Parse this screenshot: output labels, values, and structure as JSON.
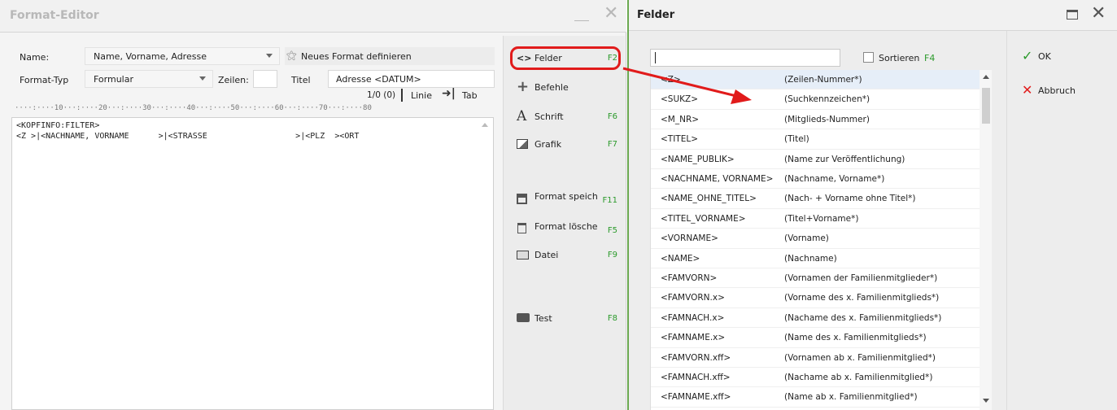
{
  "left_window": {
    "title": "Format-Editor",
    "name_label": "Name:",
    "name_value": "Name, Vorname, Adresse",
    "new_format_label": "Neues Format definieren",
    "type_label": "Format-Typ",
    "type_value": "Formular",
    "zeilen_label": "Zeilen:",
    "titel_label": "Titel",
    "titel_value": "Adresse <DATUM>",
    "position": "1/0 (0)",
    "linie_label": "Linie",
    "tab_label": "Tab",
    "ruler": "····:····10···:····20···:····30···:····40···:····50···:····60···:····70···:····80",
    "editor_lines": [
      "<KOPFINFO:FILTER>",
      "<Z >|<NACHNAME, VORNAME      >|<STRASSE                  >|<PLZ  ><ORT"
    ]
  },
  "toolbar": {
    "felder": {
      "label": "Felder",
      "key": "F2"
    },
    "befehle": {
      "label": "Befehle",
      "key": ""
    },
    "schrift": {
      "label": "Schrift",
      "key": "F6"
    },
    "grafik": {
      "label": "Grafik",
      "key": "F7"
    },
    "speichern": {
      "label": "Format speich",
      "key": "F11"
    },
    "loeschen": {
      "label": "Format lösche",
      "key": "F5"
    },
    "datei": {
      "label": "Datei",
      "key": "F9"
    },
    "test": {
      "label": "Test",
      "key": "F8"
    }
  },
  "right_window": {
    "title": "Felder",
    "search_value": "",
    "sort_label": "Sortieren",
    "sort_key": "F4",
    "ok_label": "OK",
    "cancel_label": "Abbruch",
    "fields": [
      {
        "code": "<Z>",
        "desc": "(Zeilen-Nummer*)"
      },
      {
        "code": "<SUKZ>",
        "desc": "(Suchkennzeichen*)"
      },
      {
        "code": "<M_NR>",
        "desc": "(Mitglieds-Nummer)"
      },
      {
        "code": "<TITEL>",
        "desc": "(Titel)"
      },
      {
        "code": "<NAME_PUBLIK>",
        "desc": "(Name zur Veröffentlichung)"
      },
      {
        "code": "<NACHNAME, VORNAME>",
        "desc": "(Nachname, Vorname*)"
      },
      {
        "code": "<NAME_OHNE_TITEL>",
        "desc": "(Nach- + Vorname ohne Titel*)"
      },
      {
        "code": "<TITEL_VORNAME>",
        "desc": "(Titel+Vorname*)"
      },
      {
        "code": "<VORNAME>",
        "desc": "(Vorname)"
      },
      {
        "code": "<NAME>",
        "desc": "(Nachname)"
      },
      {
        "code": "<FAMVORN>",
        "desc": "(Vornamen der Familienmitglieder*)"
      },
      {
        "code": "<FAMVORN.x>",
        "desc": "(Vorname des x. Familienmitglieds*)"
      },
      {
        "code": "<FAMNACH.x>",
        "desc": "(Nachame des x. Familienmitglieds*)"
      },
      {
        "code": "<FAMNAME.x>",
        "desc": "(Name des x. Familienmitglieds*)"
      },
      {
        "code": "<FAMVORN.xff>",
        "desc": "(Vornamen ab x. Familienmitglied*)"
      },
      {
        "code": "<FAMNACH.xff>",
        "desc": "(Nachame ab x. Familienmitglied*)"
      },
      {
        "code": "<FAMNAME.xff>",
        "desc": "(Name ab x. Familienmitglied*)"
      }
    ]
  },
  "colors": {
    "accent_green": "#2b9a2b",
    "highlight_red": "#e11b1b",
    "window_border": "#6aa84f"
  }
}
